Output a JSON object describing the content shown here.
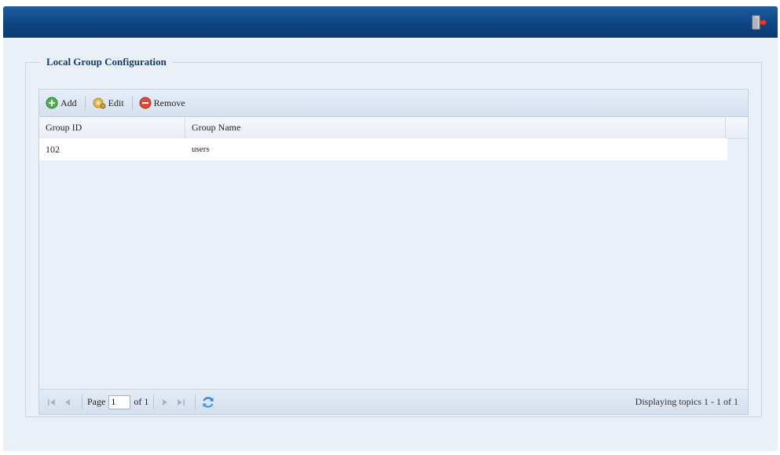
{
  "panel": {
    "title": "Local Group Configuration"
  },
  "toolbar": {
    "add_label": "Add",
    "edit_label": "Edit",
    "remove_label": "Remove"
  },
  "table": {
    "columns": [
      "Group ID",
      "Group Name"
    ],
    "rows": [
      {
        "group_id": "102",
        "group_name": "users"
      }
    ]
  },
  "pager": {
    "page_label": "Page",
    "page_value": "1",
    "of_label": "of 1",
    "display_info": "Displaying topics 1 - 1 of 1"
  },
  "colors": {
    "topbar": "#0f4584",
    "background": "#eaf0f8",
    "add_icon": "#4caf50",
    "remove_icon": "#e04a3a"
  },
  "icons": [
    "logout-icon",
    "add-icon",
    "edit-gear-icon",
    "remove-icon",
    "first-page-icon",
    "prev-page-icon",
    "next-page-icon",
    "last-page-icon",
    "refresh-icon"
  ]
}
